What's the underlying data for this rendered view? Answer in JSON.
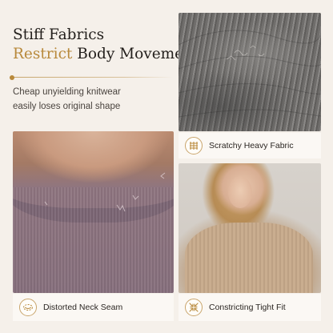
{
  "headline": {
    "line1": "Stiff Fabrics",
    "line2_accent": "Restrict",
    "line2_rest": " Body Movement",
    "subtitle_line1": "Cheap unyielding knitwear",
    "subtitle_line2": "easily loses original shape"
  },
  "colors": {
    "background": "#f5f0ea",
    "accent_gold": "#b8893b",
    "label_background": "#fbf8f4"
  },
  "features": [
    {
      "label": "Scratchy Heavy Fabric",
      "icon": "fabric-grid-icon",
      "image": "gray-knit-closeup"
    },
    {
      "label": "Distorted Neck Seam",
      "icon": "neck-seam-icon",
      "image": "mauve-sweater-neckline"
    },
    {
      "label": "Constricting Tight Fit",
      "icon": "compress-arrows-icon",
      "image": "woman-tight-ribbed-top"
    }
  ]
}
